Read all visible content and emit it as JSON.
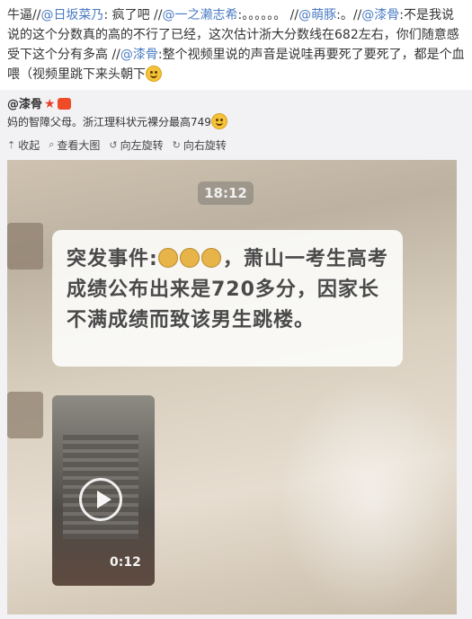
{
  "post": {
    "lead": "牛逼//",
    "mention1": "@日坂菜乃",
    "text1": ": 疯了吧 //",
    "mention2": "@一之濑志希",
    "text2": ":。。。。。。 //",
    "mention3": "@萌豚",
    "text3": ":。//",
    "mention4": "@漆骨",
    "text4": ":不是我说说的这个分数真的高的不行了已经，这次估计浙大分数线在682左右，你们随意感受下这个分有多高 //",
    "mention5": "@漆骨",
    "text5": ":整个视频里说的声音是说哇再要死了要死了，都是个血喂（视频里跳下来头朝下",
    "emoji": "smile-emoji"
  },
  "repost": {
    "author": "@漆骨",
    "text": "妈的智障父母。浙江理科状元裸分最高749",
    "toolbar": {
      "collapse": "收起",
      "view_large": "查看大图",
      "rotate_left": "向左旋转",
      "rotate_right": "向右旋转"
    }
  },
  "photo": {
    "time": "18:12",
    "bubble_line1_prefix": "突发事件:",
    "bubble_line1_suffix": "，萧山一",
    "bubble_rest": "考生高考成绩公布出来是720多分，因家长不满成绩而致该男生跳楼。",
    "video_duration": "0:12"
  }
}
